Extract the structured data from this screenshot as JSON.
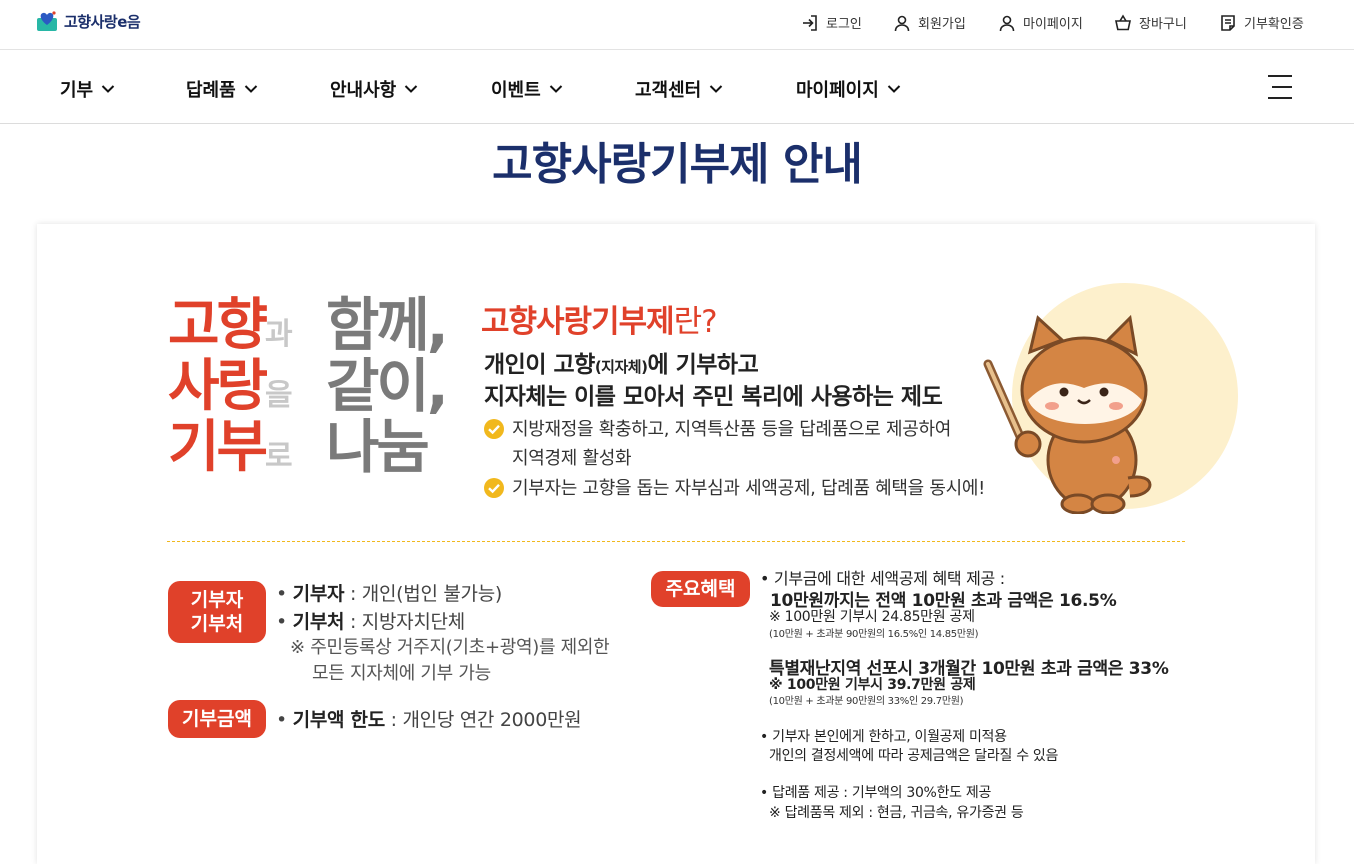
{
  "site": {
    "logo_text": "고향사랑e음"
  },
  "utility": {
    "login": "로그인",
    "signup": "회원가입",
    "mypage": "마이페이지",
    "cart": "장바구니",
    "certificate": "기부확인증"
  },
  "nav": {
    "items": [
      "기부",
      "답례품",
      "안내사항",
      "이벤트",
      "고객센터",
      "마이페이지"
    ]
  },
  "page": {
    "title": "고향사랑기부제 안내"
  },
  "slogan": {
    "line1_red": "고향",
    "line1_small": "과",
    "line1_gray": "함께,",
    "line2_red": "사랑",
    "line2_small": "을",
    "line2_gray": "같이,",
    "line3_red": "기부",
    "line3_small": "로",
    "line3_gray": "나눔"
  },
  "intro": {
    "question_main": "고향사랑기부제",
    "question_end": "란?",
    "line1_a": "개인이 고향",
    "line1_small": "(지자체)",
    "line1_b": "에 기부하고",
    "line2": "지자체는 이를 모아서 주민 복리에 사용하는 제도",
    "bullet1_a": "지방재정을 확충하고, 지역특산품 등을 답례품으로 제공하여",
    "bullet1_b": "지역경제 활성화",
    "bullet2": "기부자는 고향을 돕는 자부심과 세액공제, 답례품 혜택을 동시에!"
  },
  "details": {
    "donor_pill_1": "기부자",
    "donor_pill_2": "기부처",
    "donor_label": "기부자",
    "donor_value": "개인(법인 불가능)",
    "recipient_label": "기부처",
    "recipient_value": "지방자치단체",
    "note_1": "※ 주민등록상 거주지(기초+광역)를 제외한",
    "note_2": "모든 지자체에 기부 가능",
    "amount_pill": "기부금액",
    "amount_label": "기부액 한도",
    "amount_value": "개인당 연간 2000만원"
  },
  "benefits": {
    "pill": "주요혜택",
    "b1_line1": "• 기부금에 대한 세액공제 혜택 제공 :",
    "b1_line2": "10만원까지는 전액 10만원 초과 금액은 16.5%",
    "b1_note": "※ 100만원 기부시 24.85만원 공제",
    "b1_small": "(10만원 + 초과분 90만원의 16.5%인 14.85만원)",
    "b2_line": "특별재난지역 선포시 3개월간 10만원 초과 금액은 33%",
    "b2_note": "※ 100만원 기부시 39.7만원 공제",
    "b2_small": "(10만원 + 초과분 90만원의 33%인 29.7만원)",
    "b3_line1": "• 기부자 본인에게 한하고, 이월공제 미적용",
    "b3_line2": "개인의 결정세액에 따라 공제금액은 달라질 수 있음",
    "b4_line1": "• 답례품 제공 : 기부액의 30%한도 제공",
    "b4_line2": "※ 답례품목 제외 : 현금, 귀금속, 유가증권 등"
  },
  "colors": {
    "brand_navy": "#1b2f6b",
    "accent_red": "#e0412a",
    "check_yellow": "#f1b81d",
    "circle_cream": "#fdf0cc"
  }
}
